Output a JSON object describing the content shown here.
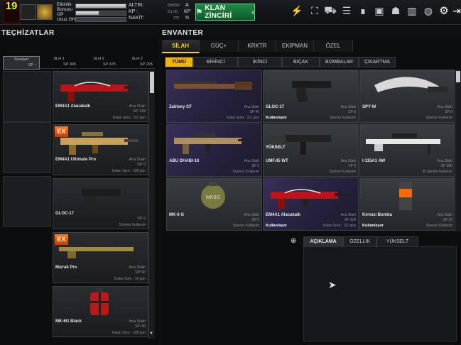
{
  "player": {
    "level": "19",
    "stat_labels": [
      "Etkinlik Bonusu",
      "GP",
      "Ucuz.GH"
    ],
    "exp_fill": 0.45,
    "currency": {
      "altin_label": "ALTIN:",
      "altin_value": "595029",
      "altin_unit": "A",
      "kp_label": "KP :",
      "kp_value": "0.1 00",
      "kp_unit": "KP",
      "nakit_label": "NAKİT:",
      "nakit_value": "2?2",
      "nakit_unit": "N"
    },
    "klan_button": "KLAN ZİNCİRİ",
    "toolbar_icons": [
      "event-icon",
      "cart-icon",
      "inbox-icon",
      "rank-icon",
      "box-icon",
      "users-icon",
      "chart-icon",
      "globe-icon",
      "gear-icon",
      "exit-icon"
    ]
  },
  "left": {
    "title": "TEÇHİZATLAR",
    "slots": [
      {
        "name": "Standart",
        "value": "SP --"
      },
      {
        "name": "SLH 1",
        "value": "SP 465"
      },
      {
        "name": "SLH 2",
        "value": "SP 475"
      },
      {
        "name": "SLH 3",
        "value": "SP 295"
      }
    ],
    "weapons": [
      {
        "name": "EM4A1 Alacakalk",
        "type": "Ana Silah",
        "sp": "SP 318",
        "bottom": "Kalan Süre : 111 gün",
        "ex": false,
        "kind": "rifle-red"
      },
      {
        "name": "EM4A1 Ultimate Pro",
        "type": "Ana Silah",
        "sp": "SP 0",
        "bottom": "Kalan Süre : 108 gün",
        "ex": true,
        "kind": "rifle-gold"
      },
      {
        "name": "GLOC-17",
        "type": "",
        "sp": "SP 0",
        "bottom": "Süresiz Kullanım",
        "ex": false,
        "kind": "pistol"
      },
      {
        "name": "Mızrak Pro",
        "type": "Ana Silah",
        "sp": "SP 50",
        "bottom": "Kalan Süre : 10 gün",
        "ex": true,
        "kind": "sniper-gold"
      },
      {
        "name": "MK-6G Black",
        "type": "Ana Silah",
        "sp": "SP 40",
        "bottom": "Kalan Süre : 108 gün",
        "ex": false,
        "kind": "grenade-red"
      }
    ],
    "scroll_fill": 0.08
  },
  "right": {
    "title": "ENVANTER",
    "tabs": [
      "SİLAH",
      "GÜÇ+",
      "KRKTR",
      "EKİPMAN",
      "ÖZEL"
    ],
    "active_tab": 0,
    "subtabs": [
      "TÜMÜ",
      "BİRİNCİ",
      "İKİNCİ",
      "BIÇAK",
      "BOMBALAR",
      "ÇIKARTMA"
    ],
    "active_subtab": 0,
    "items": [
      {
        "name": "Zaktvey CF",
        "type": "Ana Silah",
        "sp": "SP 40",
        "bottom": "Kalan Süre : 111 gün",
        "status": "",
        "bg": "purple",
        "kind": "shotgun"
      },
      {
        "name": "GLOC-17",
        "type": "Ana Silah",
        "sp": "SP 0",
        "bottom": "Süresiz Kullanım",
        "status": "Kullanılıyor",
        "bg": "gray",
        "kind": "pistol"
      },
      {
        "name": "SPY-W",
        "type": "Ana Silah",
        "sp": "SP 0",
        "bottom": "Süresiz Kullanım",
        "status": "",
        "bg": "gray",
        "kind": "knife"
      },
      {
        "name": "ABU DHABI-16",
        "type": "Ana Silah",
        "sp": "SP 0",
        "bottom": "Süresiz Kullanım",
        "status": "",
        "bg": "purple",
        "kind": "rifle-desert"
      },
      {
        "name": "UMF.45 WT",
        "type": "Ana Silah",
        "sp": "SP 0",
        "bottom": "Süresiz Kullanım",
        "status": "",
        "bg": "gray",
        "kind": "smg",
        "badge": "YÜKSELT"
      },
      {
        "name": "I-115A1 AW",
        "type": "Ana Silah",
        "sp": "SP 380",
        "bottom": "30 günlük Kullanım",
        "status": "",
        "bg": "gray",
        "kind": "sniper-white"
      },
      {
        "name": "MK-6 G",
        "type": "Ana Silah",
        "sp": "SP 0",
        "bottom": "Süresiz Kullanım",
        "status": "",
        "bg": "gray",
        "kind": "grenade"
      },
      {
        "name": "EM4A1 Alacakalk",
        "type": "Ana Silah",
        "sp": "SP 318",
        "bottom": "Kalan Süre : 111 gün",
        "status": "Kullanılıyor",
        "bg": "purple",
        "kind": "rifle-red"
      },
      {
        "name": "Kırmızı Bomba",
        "type": "Ana Silah",
        "sp": "SP 10",
        "bottom": "Süresiz Kullanım",
        "status": "Kullanılıyor",
        "bg": "gray",
        "kind": "canister"
      }
    ],
    "scroll_fill": 0.07,
    "desc_tabs": [
      "AÇIKLAMA",
      "ÖZELLİK",
      "YÜKSELT"
    ],
    "active_desc_tab": 0
  }
}
